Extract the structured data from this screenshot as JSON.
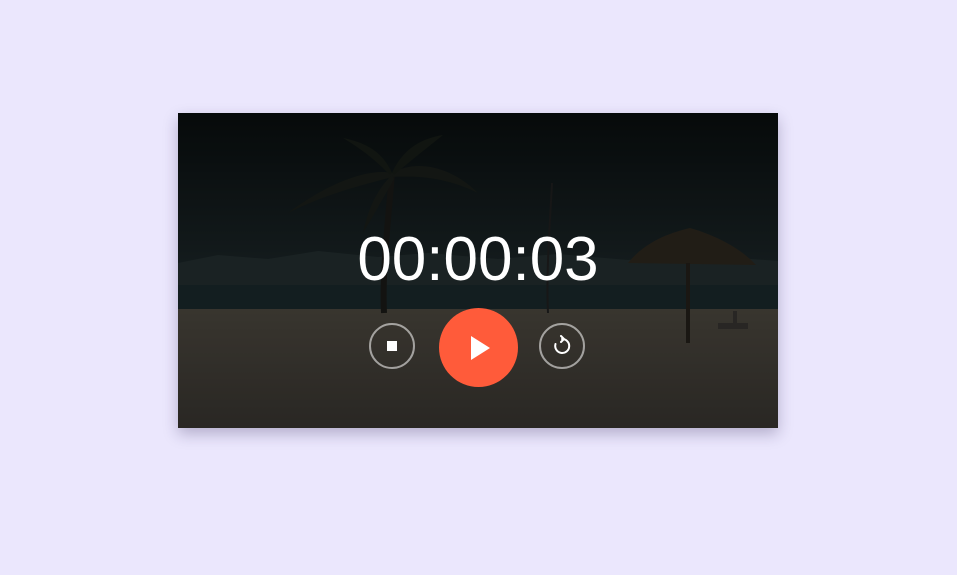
{
  "timer": {
    "display": "00:00:03"
  },
  "controls": {
    "stop_icon": "stop-icon",
    "play_icon": "play-icon",
    "reset_icon": "reset-icon"
  },
  "colors": {
    "page_background": "#ebe7fd",
    "accent": "#ff5b3a",
    "text": "#ffffff"
  }
}
